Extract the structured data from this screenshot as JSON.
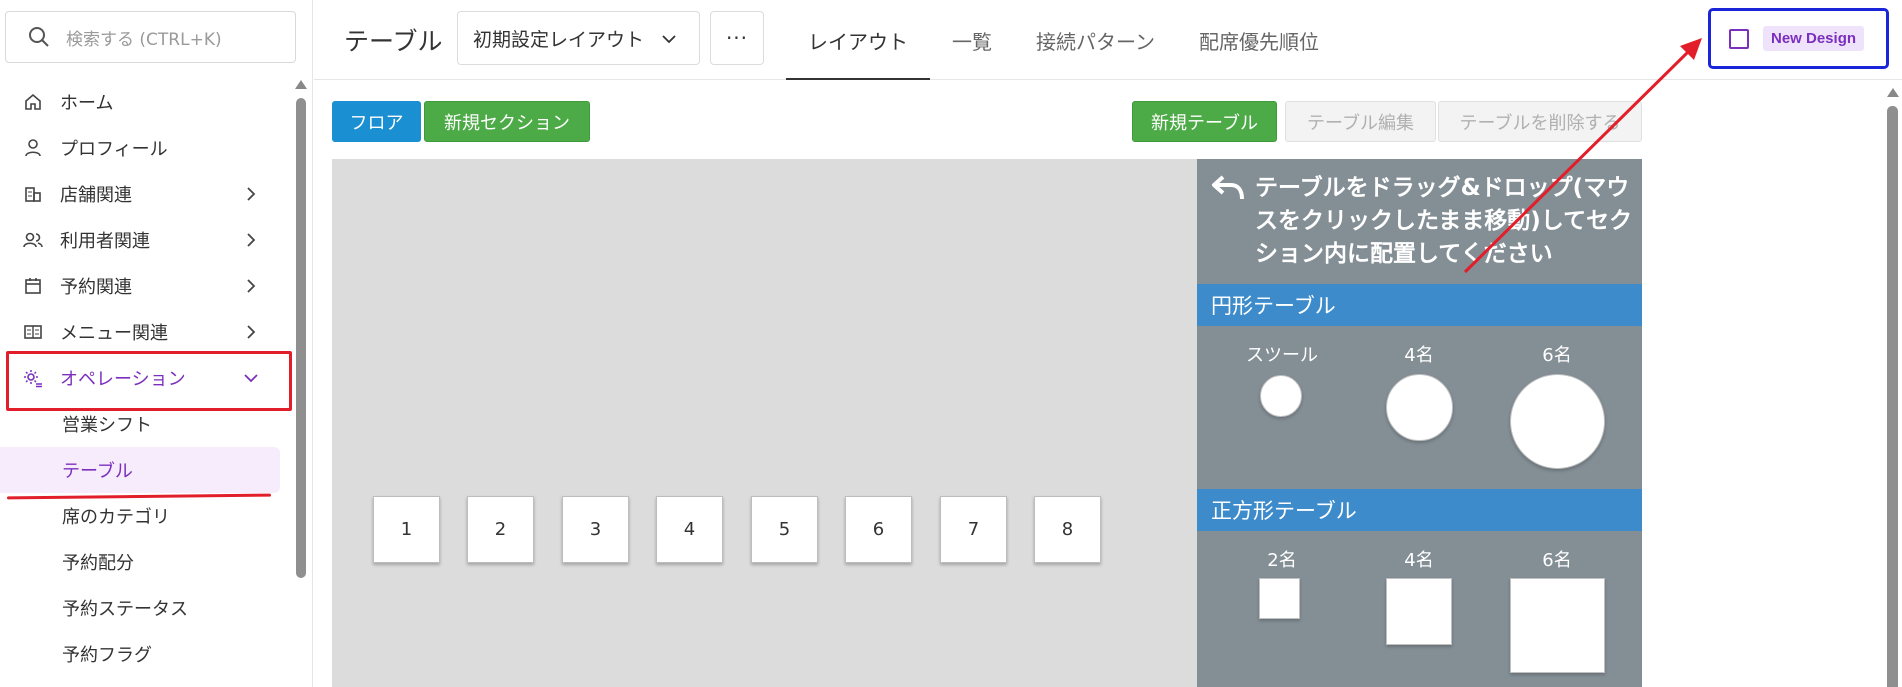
{
  "search": {
    "placeholder": "検索する (CTRL+K)"
  },
  "sidebar": {
    "items": [
      {
        "label": "ホーム",
        "icon": "home-icon"
      },
      {
        "label": "プロフィール",
        "icon": "user-icon"
      },
      {
        "label": "店舗関連",
        "icon": "building-icon"
      },
      {
        "label": "利用者関連",
        "icon": "users-icon"
      },
      {
        "label": "予約関連",
        "icon": "calendar-icon"
      },
      {
        "label": "メニュー関連",
        "icon": "menu-book-icon"
      },
      {
        "label": "オペレーション",
        "icon": "gear-list-icon"
      }
    ],
    "sub_items": [
      {
        "label": "営業シフト"
      },
      {
        "label": "テーブル"
      },
      {
        "label": "席のカテゴリ"
      },
      {
        "label": "予約配分"
      },
      {
        "label": "予約ステータス"
      },
      {
        "label": "予約フラグ"
      }
    ]
  },
  "header": {
    "title": "テーブル",
    "layout_select": "初期設定レイアウト",
    "more": "···",
    "tabs": [
      {
        "label": "レイアウト"
      },
      {
        "label": "一覧"
      },
      {
        "label": "接続パターン"
      },
      {
        "label": "配席優先順位"
      }
    ],
    "new_design": "New Design"
  },
  "toolbar": {
    "floor": "フロア",
    "new_section": "新規セクション",
    "new_table": "新規テーブル",
    "edit_table": "テーブル編集",
    "delete_table": "テーブルを削除する"
  },
  "canvas": {
    "tables": [
      "1",
      "2",
      "3",
      "4",
      "5",
      "6",
      "7",
      "8"
    ]
  },
  "palette": {
    "instruction": "テーブルをドラッグ&ドロップ(マウスをクリックしたまま移動)してセクション内に配置してください",
    "circle_header": "円形テーブル",
    "circle_labels": [
      "スツール",
      "4名",
      "6名"
    ],
    "square_header": "正方形テーブル",
    "square_labels": [
      "2名",
      "4名",
      "6名"
    ]
  },
  "colors": {
    "accent_purple": "#7b2fbe",
    "highlight_red": "#e21e2a",
    "focus_blue": "#1a24d8",
    "floor_button": "#1a8fd1",
    "green_button": "#4caa47",
    "palette_bg": "#838e95",
    "palette_header": "#3d8bcb"
  }
}
